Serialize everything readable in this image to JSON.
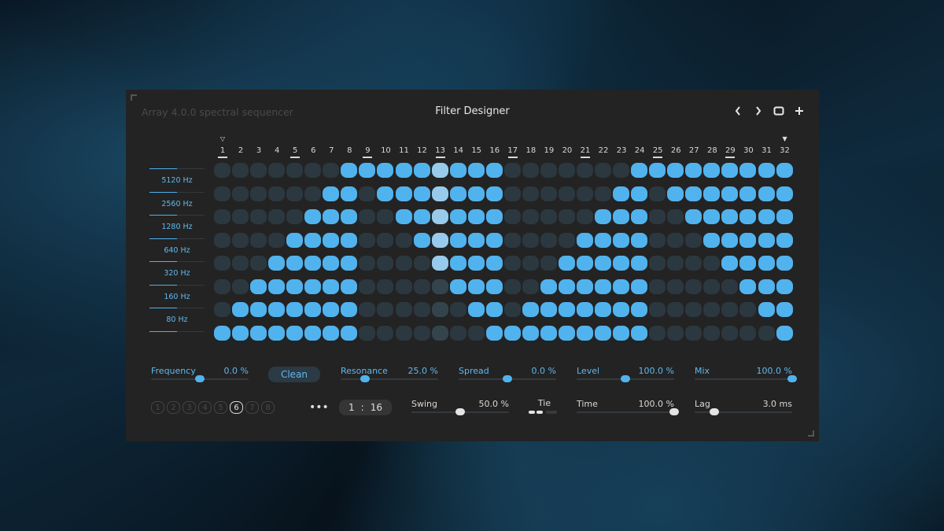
{
  "window": {
    "app_title": "Array 4.0.0 spectral sequencer",
    "preset_title": "Filter Designer",
    "nav": [
      {
        "name": "prev-preset-button",
        "icon": "chevron-left-icon"
      },
      {
        "name": "next-preset-button",
        "icon": "chevron-right-icon"
      },
      {
        "name": "window-toggle-button",
        "icon": "square-icon"
      },
      {
        "name": "add-button",
        "icon": "plus-icon"
      }
    ]
  },
  "steps": {
    "count": 32,
    "labels": [
      "1",
      "2",
      "3",
      "4",
      "5",
      "6",
      "7",
      "8",
      "9",
      "10",
      "11",
      "12",
      "13",
      "14",
      "15",
      "16",
      "17",
      "18",
      "19",
      "20",
      "21",
      "22",
      "23",
      "24",
      "25",
      "26",
      "27",
      "28",
      "29",
      "30",
      "31",
      "32"
    ],
    "underlined": [
      1,
      5,
      9,
      13,
      17,
      21,
      25,
      29
    ],
    "loop_start_marker": 1,
    "loop_end_marker": 32,
    "current_step": 13,
    "marker_glyph_start": "▽",
    "marker_glyph_end": "▼"
  },
  "bands": [
    {
      "label": "5120 Hz"
    },
    {
      "label": "2560 Hz"
    },
    {
      "label": "1280 Hz"
    },
    {
      "label": "640 Hz"
    },
    {
      "label": "320 Hz"
    },
    {
      "label": "160 Hz"
    },
    {
      "label": "80 Hz"
    }
  ],
  "grid": {
    "rows": [
      "00000001111111110000000111111111",
      "00000011011111110000001101111111",
      "00000111001111110000011100111111",
      "00001111000111110000111100011111",
      "00011111000011110001111100001111",
      "00111111000001110011111100000111",
      "01111111000000110111111100000011",
      "11111111000000011111111100000001"
    ]
  },
  "controls": {
    "frequency": {
      "label": "Frequency",
      "value": "0.0 %",
      "position": 0.5
    },
    "clean_label": "Clean",
    "resonance": {
      "label": "Resonance",
      "value": "25.0 %",
      "position": 0.25
    },
    "spread": {
      "label": "Spread",
      "value": "0.0 %",
      "position": 0.5
    },
    "level": {
      "label": "Level",
      "value": "100.0 %",
      "position": 0.5
    },
    "mix": {
      "label": "Mix",
      "value": "100.0 %",
      "position": 1.0
    },
    "swing": {
      "label": "Swing",
      "value": "50.0 %",
      "position": 0.5
    },
    "tie": {
      "label": "Tie"
    },
    "time": {
      "label": "Time",
      "value": "100.0 %",
      "position": 1.0
    },
    "lag": {
      "label": "Lag",
      "value": "3.0 ms",
      "position": 0.2
    }
  },
  "patterns": {
    "slots": [
      "1",
      "2",
      "3",
      "4",
      "5",
      "6",
      "7",
      "8"
    ],
    "active": 6,
    "more_label": "•••"
  },
  "ratio": {
    "numerator": "1",
    "separator": ":",
    "denominator": "16"
  },
  "colors": {
    "accent": "#51b3ee",
    "cell_off": "#2c3840",
    "highlight": "#98cbeb",
    "panel": "#232323"
  }
}
